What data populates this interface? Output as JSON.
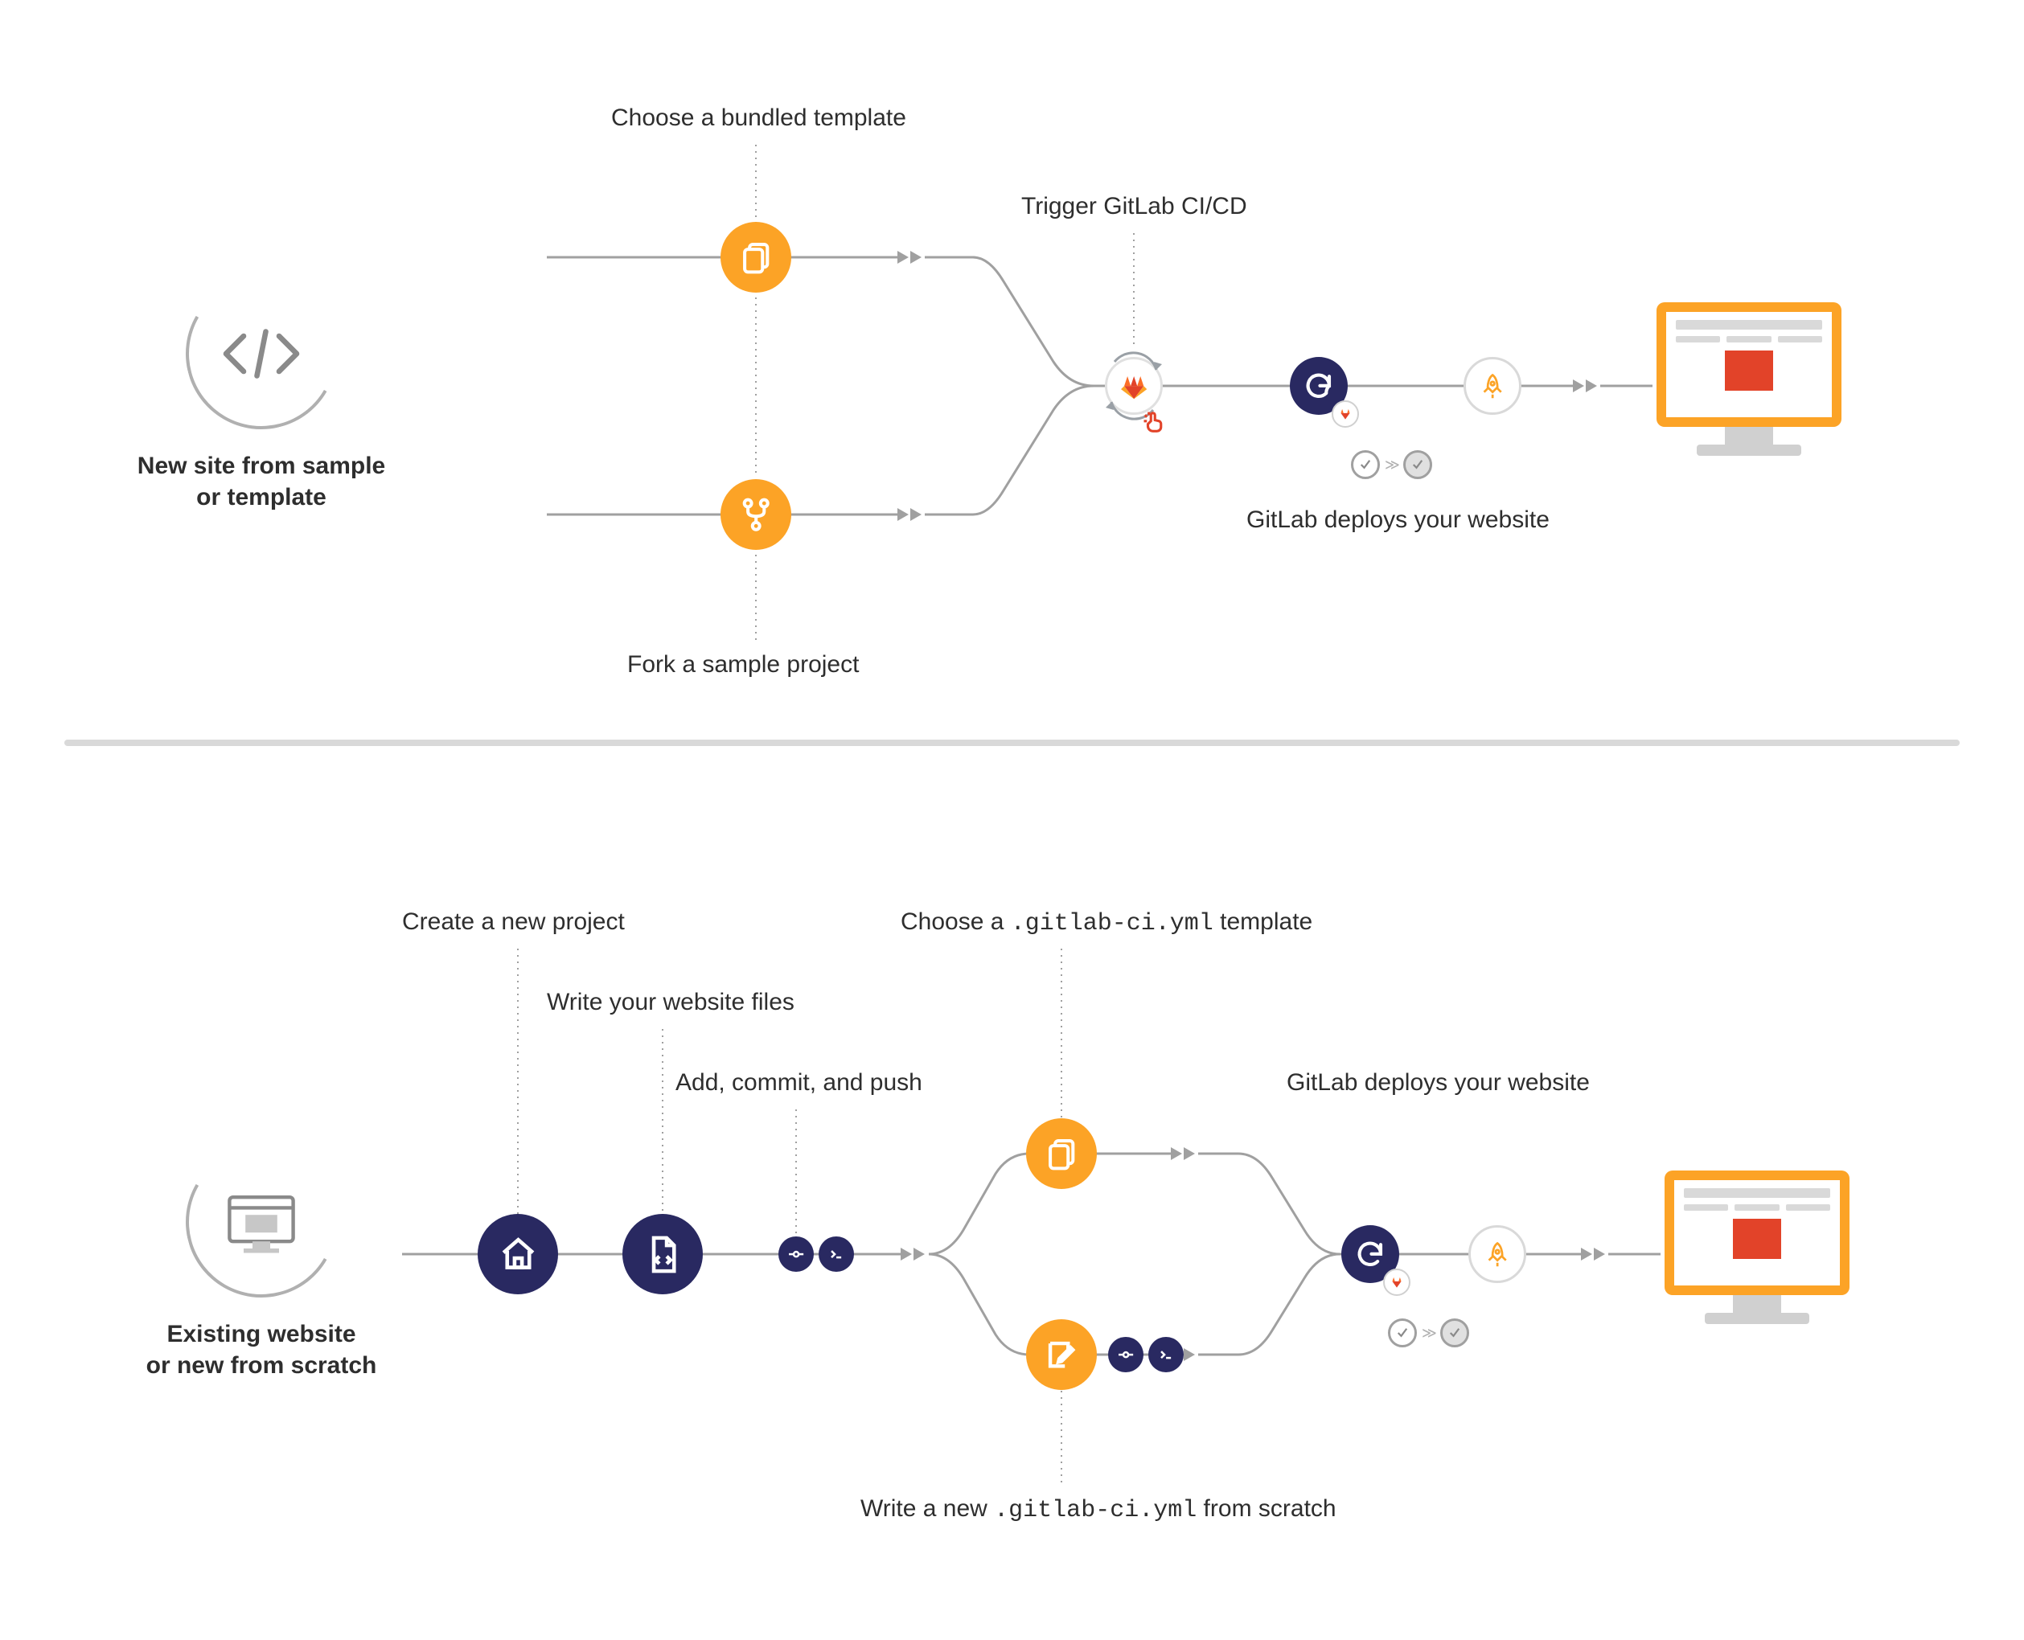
{
  "top": {
    "start_line1": "New site from sample",
    "start_line2": "or template",
    "choose_template": "Choose a bundled template",
    "fork_sample": "Fork a sample project",
    "trigger_ci": "Trigger GitLab CI/CD",
    "deploy": "GitLab deploys your website"
  },
  "bottom": {
    "start_line1": "Existing website",
    "start_line2": "or new from scratch",
    "create_project": "Create a new project",
    "write_files": "Write your website files",
    "add_commit_push": "Add, commit, and push",
    "choose_ci_pre": "Choose a ",
    "choose_ci_code": ".gitlab-ci.yml",
    "choose_ci_post": " template",
    "write_ci_pre": "Write a new ",
    "write_ci_code": ".gitlab-ci.yml",
    "write_ci_post": " from scratch",
    "deploy": "GitLab deploys your website"
  },
  "colors": {
    "orange": "#fca326",
    "purple": "#292961",
    "gitlab_red": "#e24329",
    "grey": "#a0a0a0"
  }
}
